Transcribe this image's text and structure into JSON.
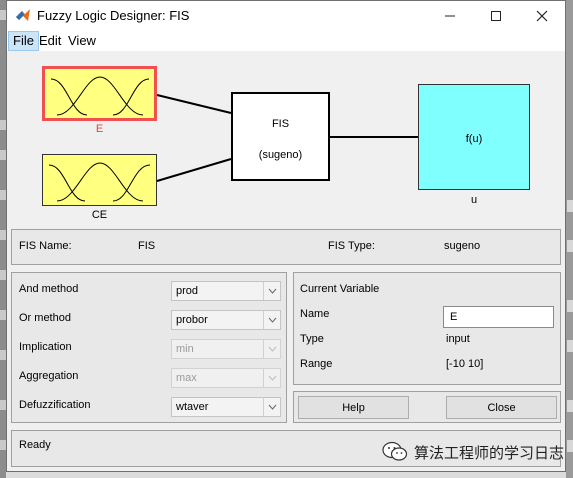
{
  "window": {
    "title": "Fuzzy Logic Designer: FIS"
  },
  "menu": {
    "items": [
      "File",
      "Edit",
      "View"
    ]
  },
  "diagram": {
    "inputs": [
      {
        "label": "E"
      },
      {
        "label": "CE"
      }
    ],
    "fis_box": {
      "line1": "FIS",
      "line2": "(sugeno)"
    },
    "output": {
      "function_label": "f(u)",
      "label": "u"
    }
  },
  "info": {
    "fis_name_label": "FIS Name:",
    "fis_name_value": "FIS",
    "fis_type_label": "FIS Type:",
    "fis_type_value": "sugeno"
  },
  "methods": {
    "and_label": "And method",
    "and_value": "prod",
    "or_label": "Or method",
    "or_value": "probor",
    "implication_label": "Implication",
    "implication_value": "min",
    "aggregation_label": "Aggregation",
    "aggregation_value": "max",
    "defuzz_label": "Defuzzification",
    "defuzz_value": "wtaver"
  },
  "current_variable": {
    "title": "Current Variable",
    "name_label": "Name",
    "name_value": "E",
    "type_label": "Type",
    "type_value": "input",
    "range_label": "Range",
    "range_value": "[-10 10]"
  },
  "buttons": {
    "help": "Help",
    "close": "Close"
  },
  "status": {
    "text": "Ready"
  },
  "watermark": {
    "text": "算法工程师的学习日志"
  },
  "colors": {
    "input_fill": "#ffff80",
    "selected_border": "#f05050",
    "output_fill": "#80ffff",
    "selected_label": "#e84040"
  }
}
